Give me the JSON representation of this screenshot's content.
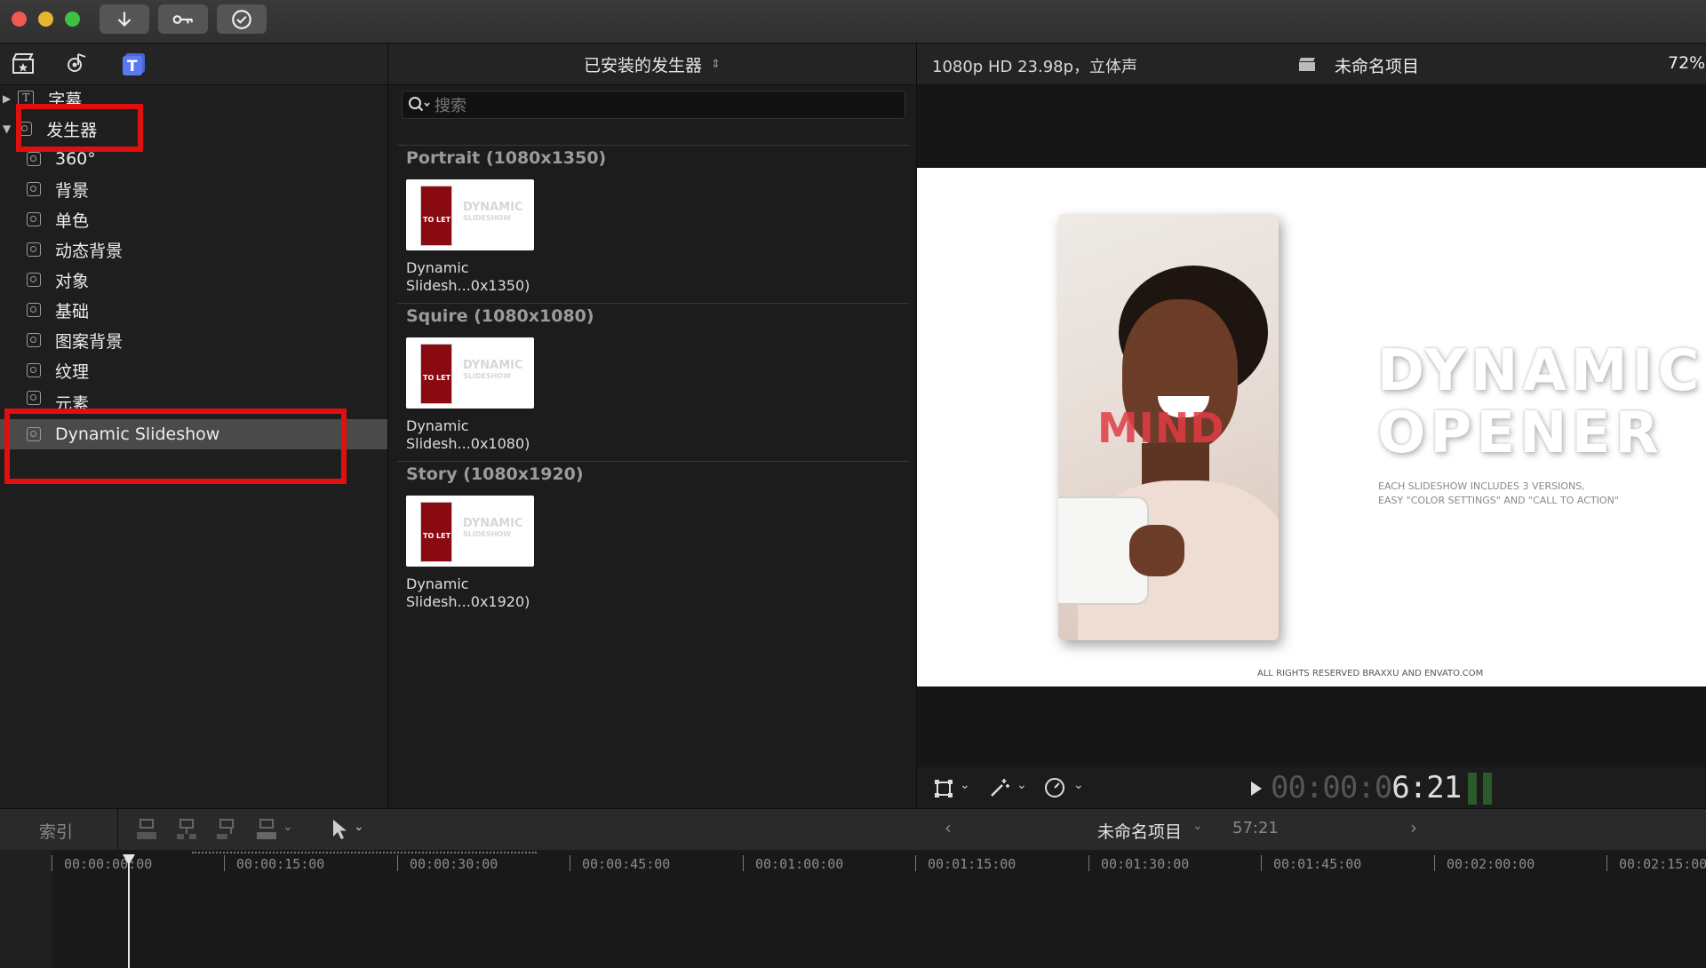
{
  "toolbar": {
    "icons": [
      "download-arrow-icon",
      "key-icon",
      "checkmark-icon"
    ]
  },
  "sidebar": {
    "items": [
      {
        "label": "字幕",
        "icon": "title-icon"
      },
      {
        "label": "发生器",
        "icon": "generator-icon"
      },
      {
        "label": "360°"
      },
      {
        "label": "背景"
      },
      {
        "label": "单色"
      },
      {
        "label": "动态背景"
      },
      {
        "label": "对象"
      },
      {
        "label": "基础"
      },
      {
        "label": "图案背景"
      },
      {
        "label": "纹理"
      },
      {
        "label": "元素"
      },
      {
        "label": "Dynamic Slideshow"
      }
    ]
  },
  "browser": {
    "header": "已安装的发生器",
    "search_placeholder": "搜索",
    "sections": [
      {
        "title": "Portrait (1080x1350)",
        "clip_line1": "Dynamic",
        "clip_line2": "Slidesh...0x1350)"
      },
      {
        "title": "Squire (1080x1080)",
        "clip_line1": "Dynamic",
        "clip_line2": "Slidesh...0x1080)"
      },
      {
        "title": "Story (1080x1920)",
        "clip_line1": "Dynamic",
        "clip_line2": "Slidesh...0x1920)"
      }
    ],
    "thumb_text_1": "DYNAMIC",
    "thumb_text_2": "SLIDESHOW",
    "thumb_phone_text": "TO LET"
  },
  "viewer": {
    "format": "1080p HD 23.98p，立体声",
    "project": "未命名项目",
    "zoom": "72%",
    "canvas": {
      "headline1": "DYNAMIC",
      "headline2": "OPENER",
      "overlay_word": "MIND",
      "sub1": "EACH SLIDESHOW INCLUDES 3 VERSIONS,",
      "sub2": "EASY \"COLOR SETTINGS\" AND \"CALL TO ACTION\"",
      "footer": "ALL RIGHTS RESERVED BRAXXU AND ENVATO.COM"
    },
    "timecode_dim": "00:00:0",
    "timecode_bright": "6:21"
  },
  "timeline": {
    "index_label": "索引",
    "project": "未命名项目",
    "duration": "57:21",
    "ruler": [
      "00:00:00:00",
      "00:00:15:00",
      "00:00:30:00",
      "00:00:45:00",
      "00:01:00:00",
      "00:01:15:00",
      "00:01:30:00",
      "00:01:45:00",
      "00:02:00:00",
      "00:02:15:00"
    ]
  },
  "colors": {
    "highlight_red": "#e01010",
    "accent_blue": "#4a64d8"
  }
}
